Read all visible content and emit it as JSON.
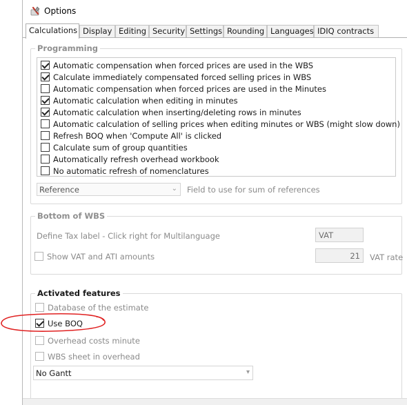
{
  "window": {
    "title": "Options",
    "icon": "options-tools-icon"
  },
  "tabs": [
    {
      "label": "Calculations",
      "active": true
    },
    {
      "label": "Display",
      "active": false
    },
    {
      "label": "Editing",
      "active": false
    },
    {
      "label": "Security",
      "active": false
    },
    {
      "label": "Settings",
      "active": false
    },
    {
      "label": "Rounding",
      "active": false
    },
    {
      "label": "Languages",
      "active": false
    },
    {
      "label": "IDIQ contracts",
      "active": false
    }
  ],
  "programming": {
    "title": "Programming",
    "items": [
      {
        "label": "Automatic compensation when forced prices are used in the WBS",
        "checked": true
      },
      {
        "label": "Calculate immediately compensated forced selling prices in WBS",
        "checked": true
      },
      {
        "label": "Automatic compensation when forced prices are used in the Minutes",
        "checked": false
      },
      {
        "label": "Automatic calculation when editing in minutes",
        "checked": true
      },
      {
        "label": "Automatic calculation when inserting/deleting rows in minutes",
        "checked": true
      },
      {
        "label": "Automatic calculation of selling prices when editing minutes or WBS (might slow down)",
        "checked": false
      },
      {
        "label": "Refresh BOQ when 'Compute All' is clicked",
        "checked": false
      },
      {
        "label": "Calculate sum of group quantities",
        "checked": false
      },
      {
        "label": "Automatically refresh overhead workbook",
        "checked": false
      },
      {
        "label": "No automatic refresh of nomenclatures",
        "checked": false
      }
    ],
    "reference_select": {
      "value": "Reference",
      "label": "Field to use for sum of references"
    }
  },
  "bottom_of_wbs": {
    "title": "Bottom of WBS",
    "tax_label": "Define Tax label - Click right for Multilanguage",
    "tax_value": "VAT",
    "show_vat_label": "Show VAT and ATI amounts",
    "show_vat_checked": false,
    "vat_rate_value": "21",
    "vat_rate_label": "VAT rate"
  },
  "activated_features": {
    "title": "Activated features",
    "items": [
      {
        "label": "Database of the estimate",
        "checked": false
      },
      {
        "label": "Use BOQ",
        "checked": true
      },
      {
        "label": "Overhead costs minute",
        "checked": false
      },
      {
        "label": "WBS sheet in overhead",
        "checked": false
      }
    ],
    "gantt_select": {
      "value": "No Gantt"
    }
  },
  "colors": {
    "annotation": "#e02020",
    "border": "#d9d9d9",
    "dim_text": "#8a8a8a"
  }
}
